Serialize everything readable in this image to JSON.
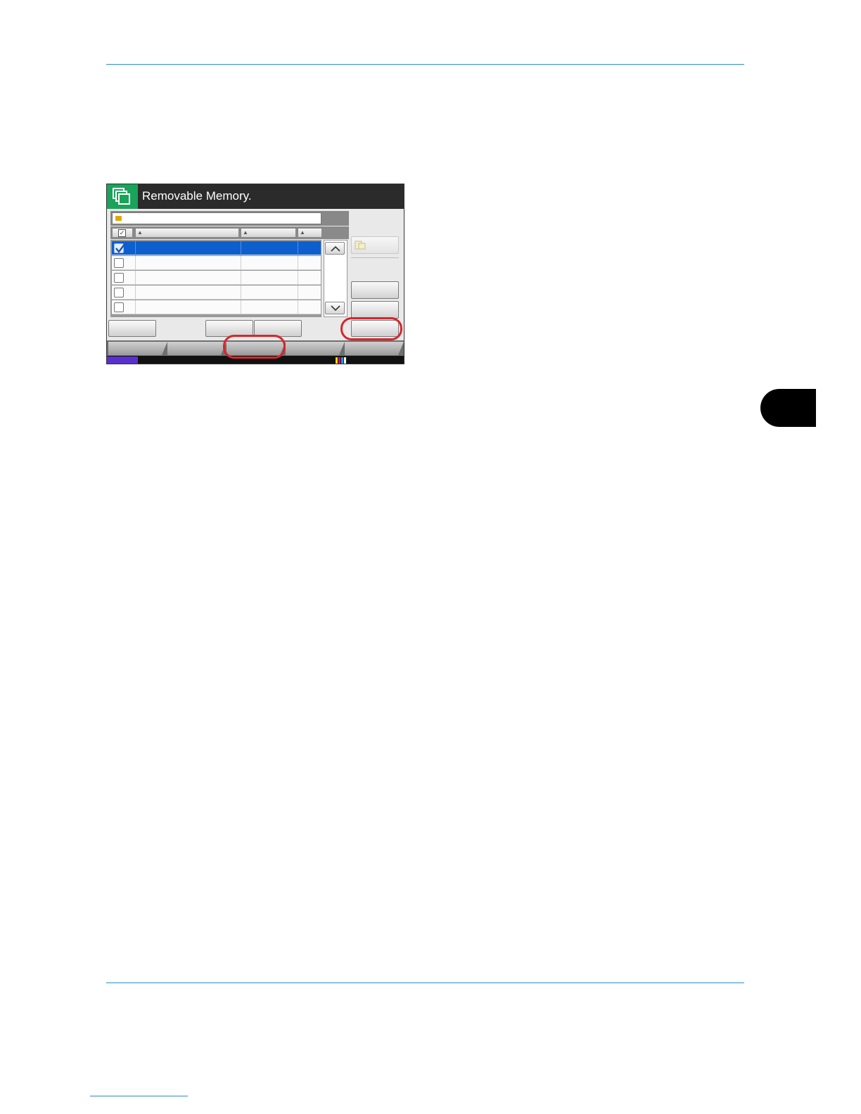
{
  "screen": {
    "title": "Removable Memory."
  },
  "file_list": {
    "rows": [
      {
        "checked": true
      },
      {
        "checked": false
      },
      {
        "checked": false
      },
      {
        "checked": false
      },
      {
        "checked": false
      }
    ]
  },
  "colors": {
    "header_rule": "#2a8fc9",
    "app_icon_bg": "#1aa35a",
    "selected_row": "#0d5fce",
    "callout": "#d6262b"
  },
  "icons": {
    "app": "removable-memory-icon",
    "folder": "folder-icon",
    "scroll_up": "chevron-up-icon",
    "scroll_down": "chevron-down-icon"
  }
}
